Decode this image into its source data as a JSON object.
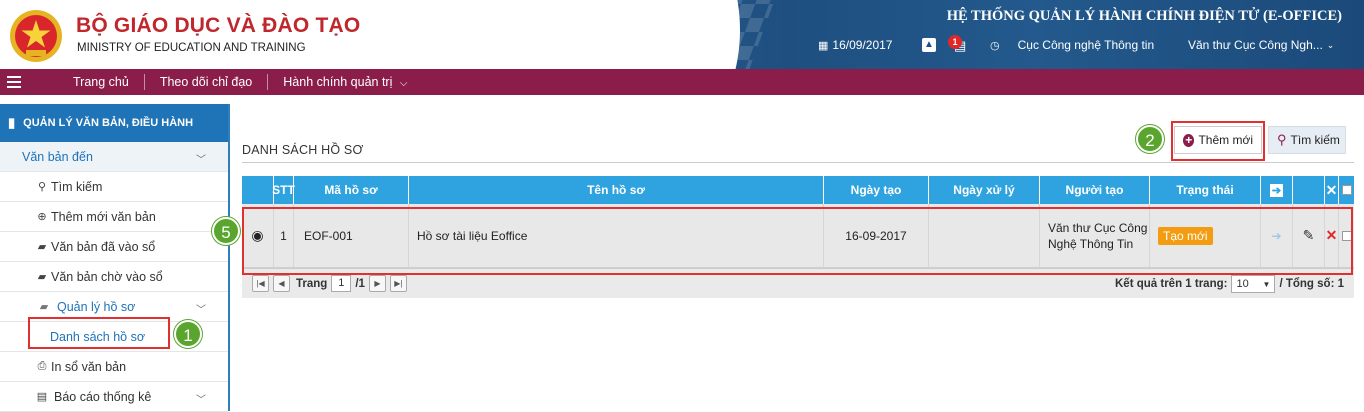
{
  "header": {
    "brand_vn": "BỘ GIÁO DỤC VÀ ĐÀO TẠO",
    "brand_en": "MINISTRY OF EDUCATION AND TRAINING",
    "system_title": "HỆ THỐNG QUẢN LÝ HÀNH CHÍNH ĐIỆN TỬ (E-OFFICE)",
    "date": "16/09/2017",
    "notification_count": "1",
    "department": "Cục Công nghệ Thông tin",
    "user": "Văn thư Cục Công Ngh..."
  },
  "nav": {
    "items": [
      "Trang chủ",
      "Theo dõi chỉ đạo",
      "Hành chính quản trị"
    ]
  },
  "sidebar": {
    "section_title": "QUẢN LÝ VĂN BẢN, ĐIỀU HÀNH",
    "incoming": "Văn bản đến",
    "items": {
      "search": "Tìm kiếm",
      "add_doc": "Thêm mới văn bản",
      "registered": "Văn bản đã vào sổ",
      "pending": "Văn bản chờ vào sổ",
      "manage_files": "Quản lý hồ sơ",
      "file_list": "Danh sách hồ sơ",
      "print": "In sổ văn bản",
      "report": "Báo cáo thống kê"
    }
  },
  "annotations": {
    "badge1": "1",
    "badge2": "2",
    "badge5": "5"
  },
  "main": {
    "title": "DANH SÁCH HỒ SƠ",
    "add_button": "Thêm mới",
    "search_button": "Tìm kiếm",
    "columns": {
      "stt": "STT",
      "code": "Mã hồ sơ",
      "name": "Tên hồ sơ",
      "created": "Ngày tạo",
      "processed": "Ngày xử lý",
      "creator": "Người tạo",
      "status": "Trạng thái"
    },
    "row": {
      "stt": "1",
      "code": "EOF-001",
      "name": "Hồ sơ tài liệu Eoffice",
      "created": "16-09-2017",
      "processed": "",
      "creator": "Văn thư Cục Công Nghệ Thông Tin",
      "status": "Tạo mới"
    },
    "pager": {
      "page_label": "Trang",
      "page": "1",
      "total_pages": "/1",
      "per_page_label": "Kết quả trên 1 trang:",
      "per_page": "10",
      "total_label": "/ Tổng số: 1"
    }
  },
  "colors": {
    "nav": "#8b1d4a",
    "sidebar_head": "#1f73b7",
    "grid_head": "#2fa3df",
    "status_tag": "#f39c12",
    "annotation": "#5aa52e"
  }
}
